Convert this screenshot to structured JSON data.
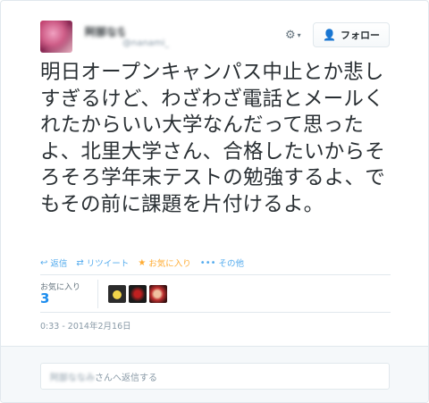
{
  "tweet": {
    "author": {
      "display_name": "阿部ななみ",
      "handle": "@nanami_a"
    },
    "follow_label": "フォロー",
    "text": "明日オープンキャンパス中止とか悲しすぎるけど、わざわざ電話とメールくれたからいい大学なんだって思ったよ、北里大学さん、合格したいからそろそろ学年末テストの勉強するよ、でもその前に課題を片付けるよ。",
    "actions": {
      "reply": "返信",
      "retweet": "リツイート",
      "favorite": "お気に入り",
      "more": "その他"
    },
    "stats": {
      "favorites_label": "お気に入り",
      "favorites_count": "3"
    },
    "timestamp": "0:33 - 2014年2月16日",
    "reply": {
      "target_name": "阿部ななみ",
      "suffix": "さんへ返信する"
    }
  },
  "icons": {
    "settings": "gear-icon",
    "follow": "follow-person-icon",
    "reply": "reply-icon",
    "retweet": "retweet-icon",
    "favorite": "star-icon",
    "more": "more-dots-icon"
  },
  "colors": {
    "accent": "#55acee",
    "favorite": "#ffac33",
    "count": "#1d8dee",
    "text": "#292f33",
    "muted": "#8899a6"
  }
}
